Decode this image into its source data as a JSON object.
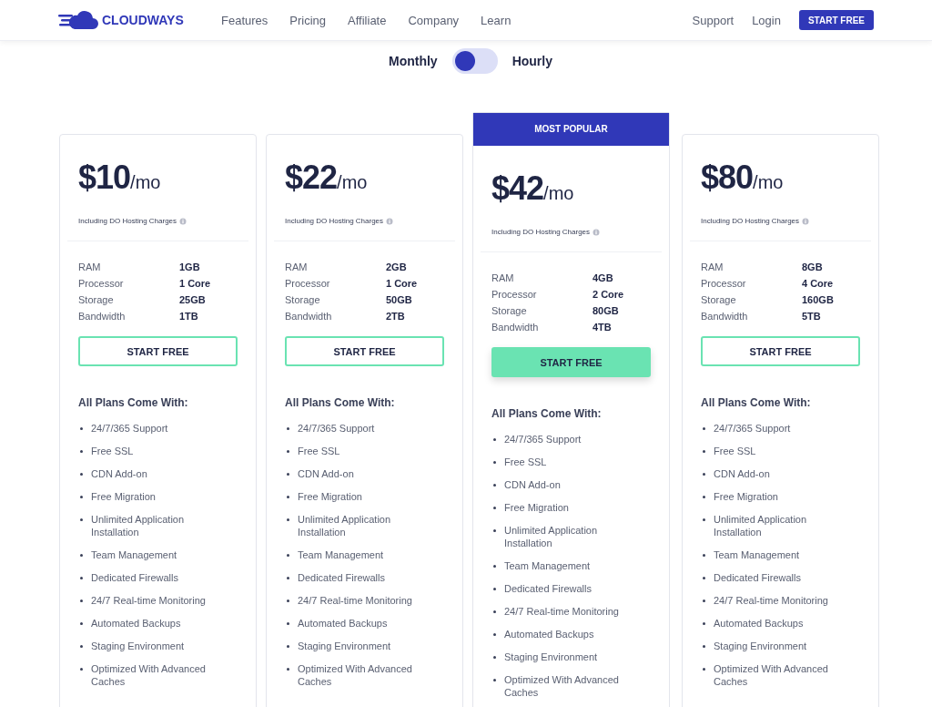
{
  "header": {
    "brand": "CLOUDWAYS",
    "nav": [
      "Features",
      "Pricing",
      "Affiliate",
      "Company",
      "Learn"
    ],
    "links": [
      "Support",
      "Login"
    ],
    "cta": "START FREE"
  },
  "billing": {
    "left_label": "Monthly",
    "right_label": "Hourly",
    "on": false
  },
  "plans": [
    {
      "featured": false,
      "price": "$10",
      "unit": "/mo",
      "note": "Including DO Hosting Charges",
      "specs": [
        {
          "label": "RAM",
          "value": "1GB"
        },
        {
          "label": "Processor",
          "value": "1 Core"
        },
        {
          "label": "Storage",
          "value": "25GB"
        },
        {
          "label": "Bandwidth",
          "value": "1TB"
        }
      ],
      "button": "START FREE",
      "features_title": "All Plans Come With:",
      "features": [
        "24/7/365 Support",
        "Free SSL",
        "CDN Add-on",
        "Free Migration",
        "Unlimited Application Installation",
        "Team Management",
        "Dedicated Firewalls",
        "24/7 Real-time Monitoring",
        "Automated Backups",
        "Staging Environment",
        "Optimized With Advanced Caches"
      ]
    },
    {
      "featured": false,
      "price": "$22",
      "unit": "/mo",
      "note": "Including DO Hosting Charges",
      "specs": [
        {
          "label": "RAM",
          "value": "2GB"
        },
        {
          "label": "Processor",
          "value": "1 Core"
        },
        {
          "label": "Storage",
          "value": "50GB"
        },
        {
          "label": "Bandwidth",
          "value": "2TB"
        }
      ],
      "button": "START FREE",
      "features_title": "All Plans Come With:",
      "features": [
        "24/7/365 Support",
        "Free SSL",
        "CDN Add-on",
        "Free Migration",
        "Unlimited Application Installation",
        "Team Management",
        "Dedicated Firewalls",
        "24/7 Real-time Monitoring",
        "Automated Backups",
        "Staging Environment",
        "Optimized With Advanced Caches"
      ]
    },
    {
      "featured": true,
      "badge": "MOST POPULAR",
      "price": "$42",
      "unit": "/mo",
      "note": "Including DO Hosting Charges",
      "specs": [
        {
          "label": "RAM",
          "value": "4GB"
        },
        {
          "label": "Processor",
          "value": "2 Core"
        },
        {
          "label": "Storage",
          "value": "80GB"
        },
        {
          "label": "Bandwidth",
          "value": "4TB"
        }
      ],
      "button": "START FREE",
      "features_title": "All Plans Come With:",
      "features": [
        "24/7/365 Support",
        "Free SSL",
        "CDN Add-on",
        "Free Migration",
        "Unlimited Application Installation",
        "Team Management",
        "Dedicated Firewalls",
        "24/7 Real-time Monitoring",
        "Automated Backups",
        "Staging Environment",
        "Optimized With Advanced Caches"
      ]
    },
    {
      "featured": false,
      "price": "$80",
      "unit": "/mo",
      "note": "Including DO Hosting Charges",
      "specs": [
        {
          "label": "RAM",
          "value": "8GB"
        },
        {
          "label": "Processor",
          "value": "4 Core"
        },
        {
          "label": "Storage",
          "value": "160GB"
        },
        {
          "label": "Bandwidth",
          "value": "5TB"
        }
      ],
      "button": "START FREE",
      "features_title": "All Plans Come With:",
      "features": [
        "24/7/365 Support",
        "Free SSL",
        "CDN Add-on",
        "Free Migration",
        "Unlimited Application Installation",
        "Team Management",
        "Dedicated Firewalls",
        "24/7 Real-time Monitoring",
        "Automated Backups",
        "Staging Environment",
        "Optimized With Advanced Caches"
      ]
    }
  ]
}
